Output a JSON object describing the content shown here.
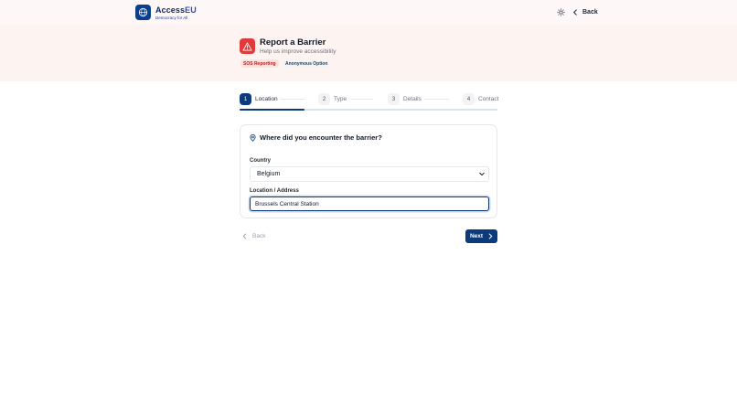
{
  "header": {
    "brand_part1": "Access",
    "brand_part2": "EU",
    "tagline": "Democracy for All",
    "back_label": "Back",
    "icons": {
      "logo": "globe-icon",
      "theme": "sun-icon",
      "back": "chevron-left-icon"
    }
  },
  "hero": {
    "title": "Report a Barrier",
    "subtitle": "Help us improve accessibility",
    "tags": [
      "SOS Reporting",
      "Anonymous Option"
    ],
    "icon": "warning-triangle-icon"
  },
  "stepper": {
    "steps": [
      {
        "num": "1",
        "label": "Location"
      },
      {
        "num": "2",
        "label": "Type"
      },
      {
        "num": "3",
        "label": "Details"
      },
      {
        "num": "4",
        "label": "Contact"
      }
    ],
    "current_step": 1,
    "progress_fraction": 0.25
  },
  "form": {
    "title": "Where did you encounter the barrier?",
    "title_icon": "map-pin-icon",
    "country_label": "Country",
    "country_value": "Belgium",
    "location_label": "Location / Address",
    "location_value": "Brussels Central Station"
  },
  "nav": {
    "back_label": "Back",
    "next_label": "Next"
  },
  "colors": {
    "primary": "#0c3a7a",
    "danger": "#e23a3a",
    "hero_bg": "#fdf3f0"
  }
}
